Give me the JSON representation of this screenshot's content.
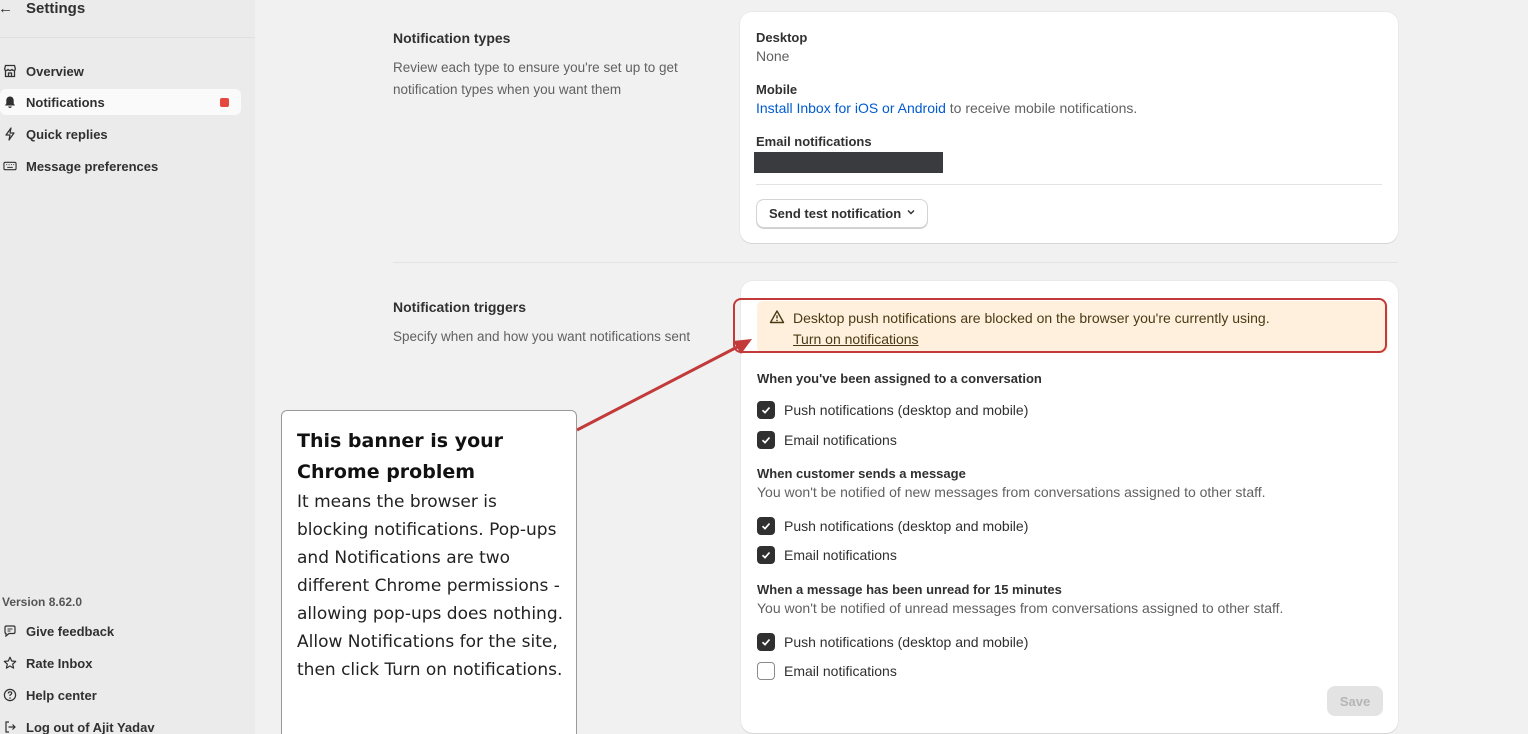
{
  "sidebar": {
    "back_icon": "arrow-left-icon",
    "title": "Settings",
    "items": [
      {
        "label": "Overview",
        "icon": "store-icon"
      },
      {
        "label": "Notifications",
        "icon": "bell-icon",
        "active": true,
        "badge_color": "#e5483f"
      },
      {
        "label": "Quick replies",
        "icon": "lightning-icon"
      },
      {
        "label": "Message preferences",
        "icon": "keyboard-icon"
      }
    ],
    "version": "Version 8.62.0",
    "footer_items": [
      {
        "label": "Give feedback",
        "icon": "chat-bubble-icon"
      },
      {
        "label": "Rate Inbox",
        "icon": "star-icon"
      },
      {
        "label": "Help center",
        "icon": "question-circle-icon"
      },
      {
        "label": "Log out of Ajit Yadav",
        "icon": "logout-icon"
      }
    ]
  },
  "types_section": {
    "title": "Notification types",
    "description": "Review each type to ensure you're set up to get notification types when you want them",
    "desktop_label": "Desktop",
    "desktop_value": "None",
    "mobile_label": "Mobile",
    "mobile_link": "Install Inbox for iOS or Android",
    "mobile_suffix": " to receive mobile notifications.",
    "email_label": "Email notifications",
    "test_button": "Send test notification"
  },
  "triggers_section": {
    "title": "Notification triggers",
    "description": "Specify when and how you want notifications sent",
    "banner": {
      "message": "Desktop push notifications are blocked on the browser you're currently using.",
      "link": "Turn on notifications",
      "color": "#fff0de"
    },
    "groups": [
      {
        "title": "When you've been assigned to a conversation",
        "note": "",
        "options": [
          {
            "label": "Push notifications (desktop and mobile)",
            "checked": true
          },
          {
            "label": "Email notifications",
            "checked": true
          }
        ]
      },
      {
        "title": "When customer sends a message",
        "note": "You won't be notified of new messages from conversations assigned to other staff.",
        "options": [
          {
            "label": "Push notifications (desktop and mobile)",
            "checked": true
          },
          {
            "label": "Email notifications",
            "checked": true
          }
        ]
      },
      {
        "title": "When a message has been unread for 15 minutes",
        "note": "You won't be notified of unread messages from conversations assigned to other staff.",
        "options": [
          {
            "label": "Push notifications (desktop and mobile)",
            "checked": true
          },
          {
            "label": "Email notifications",
            "checked": false
          }
        ]
      }
    ],
    "save_button": "Save"
  },
  "annotation": {
    "heading": "This banner is your Chrome problem",
    "body": "It means the browser is blocking notifications. Pop-ups and Notifications are two different Chrome permissions - allowing pop-ups does nothing. Allow Notifications for the site, then click Turn on notifications.",
    "color": "#c23a3a"
  }
}
